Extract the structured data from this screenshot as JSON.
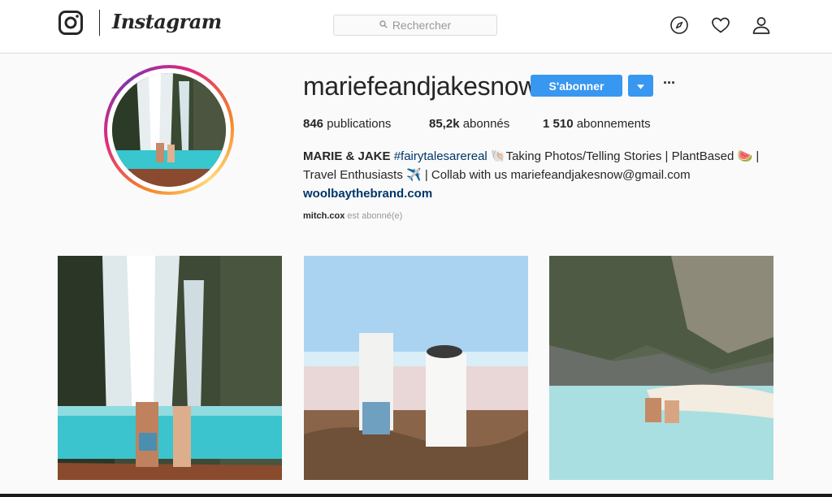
{
  "nav": {
    "brand": "Instagram",
    "search_placeholder": "Rechercher",
    "icons": [
      "instagram-glyph-icon",
      "compass-icon",
      "heart-icon",
      "person-icon"
    ]
  },
  "profile": {
    "username": "mariefeandjakesnow",
    "follow_label": "S'abonner",
    "stats": {
      "posts_count": "846",
      "posts_label": "publications",
      "followers_count": "85,2k",
      "followers_label": "abonnés",
      "following_count": "1 510",
      "following_label": "abonnements"
    },
    "bio": {
      "name": "MARIE & JAKE",
      "hashtag": "#fairytalesarereal",
      "line1_rest": " 🐚Taking Photos/Telling Stories | PlantBased 🍉 |",
      "line2": "Travel Enthusiasts ✈️ | Collab with us mariefeandjakesnow@gmail.com",
      "website": "woolbaythebrand.com"
    },
    "followed_by_user": "mitch.cox",
    "followed_by_text": " est abonné(e)"
  },
  "posts": [
    {
      "subject": "waterfall couple"
    },
    {
      "subject": "beach walk couple"
    },
    {
      "subject": "lagoon rocks couple"
    }
  ],
  "colors": {
    "accent": "#3897f0",
    "link": "#003569",
    "muted": "#999999",
    "text": "#262626",
    "background": "#fafafa"
  }
}
